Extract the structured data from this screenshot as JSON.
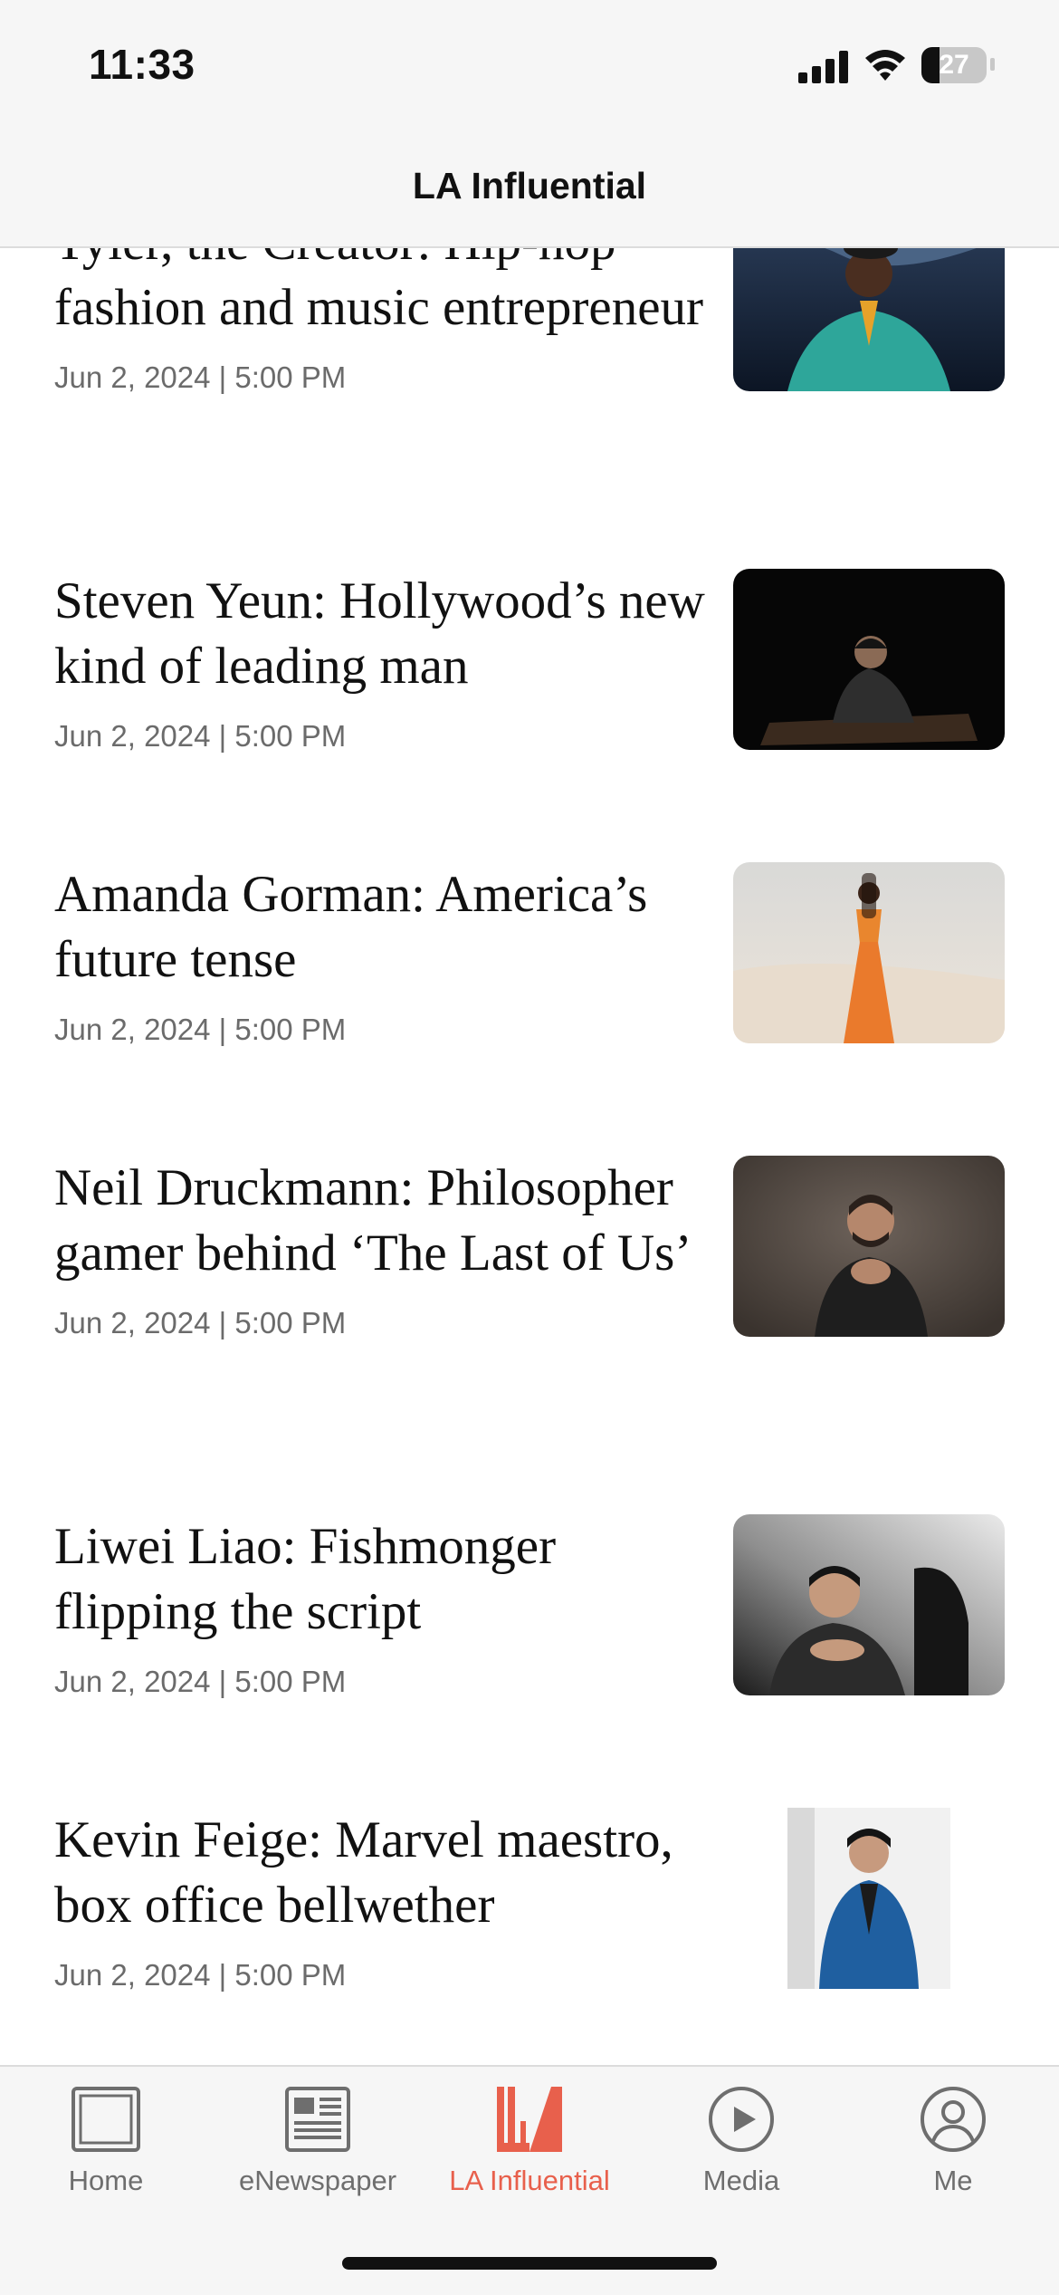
{
  "status_bar": {
    "time": "11:33",
    "battery": "27"
  },
  "header": {
    "title": "LA Influential"
  },
  "articles": [
    {
      "title": "Tyler, the Creator: Hip-hop fashion and music entrepreneur",
      "date": "Jun 2, 2024 | 5:00 PM"
    },
    {
      "title": "Steven Yeun: Hollywood’s new kind of leading man",
      "date": "Jun 2, 2024 | 5:00 PM"
    },
    {
      "title": "Amanda Gorman: America’s future tense",
      "date": "Jun 2, 2024 | 5:00 PM"
    },
    {
      "title": "Neil Druckmann: Philosopher gamer behind ‘The Last of Us’",
      "date": "Jun 2, 2024 | 5:00 PM"
    },
    {
      "title": "Liwei Liao: Fishmonger flipping the script",
      "date": "Jun 2, 2024 | 5:00 PM"
    },
    {
      "title": "Kevin Feige: Marvel maestro, box office bellwether",
      "date": "Jun 2, 2024 | 5:00 PM"
    }
  ],
  "tabbar": {
    "tabs": [
      {
        "label": "Home",
        "icon": "home-icon"
      },
      {
        "label": "eNewspaper",
        "icon": "newspaper-icon"
      },
      {
        "label": "LA Influential",
        "icon": "la-influential-icon",
        "active": true
      },
      {
        "label": "Media",
        "icon": "play-circle-icon"
      },
      {
        "label": "Me",
        "icon": "profile-icon"
      }
    ],
    "active_color": "#e8604c",
    "inactive_color": "#6e6e6e"
  }
}
